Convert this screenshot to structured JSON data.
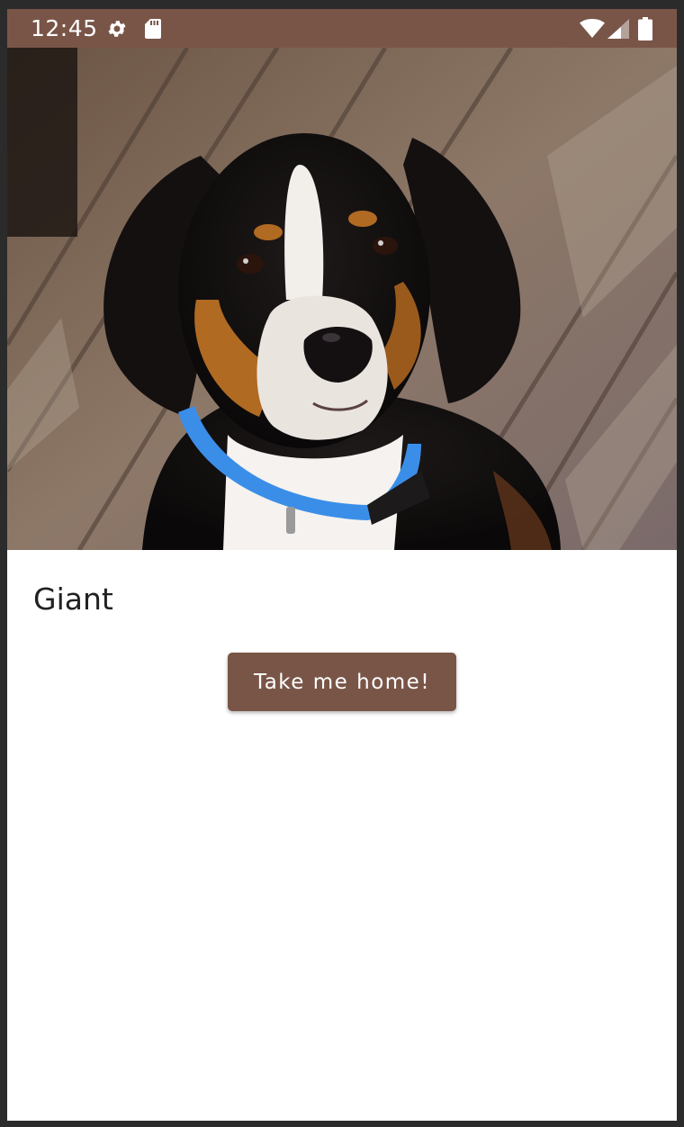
{
  "status_bar": {
    "time": "12:45",
    "icons": [
      "settings-icon",
      "sd-card-icon",
      "wifi-icon",
      "cell-signal-icon",
      "battery-icon"
    ],
    "background": "#795548"
  },
  "pet": {
    "photo_alt": "",
    "name": "Giant"
  },
  "actions": {
    "adopt_label": "Take me home!"
  },
  "colors": {
    "primary": "#795548",
    "text": "#212121",
    "background": "#ffffff"
  }
}
